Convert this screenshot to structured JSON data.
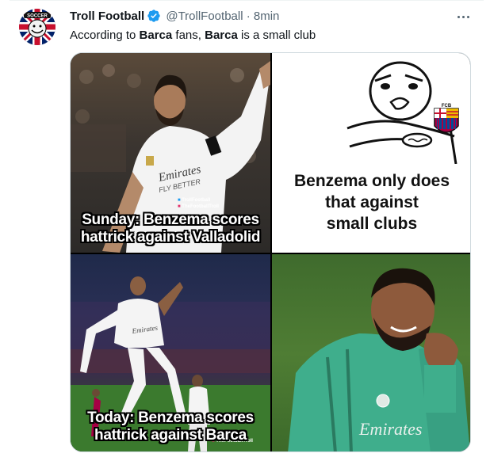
{
  "tweet": {
    "author_name": "Troll Football",
    "handle": "@TrollFootball",
    "separator": "·",
    "time": "8min",
    "text_parts": [
      "According to ",
      "Barca",
      " fans, ",
      "Barca",
      " is a small club"
    ]
  },
  "avatar": {
    "text": "SOCCER"
  },
  "meme": {
    "top_left_caption": [
      "Sunday: Benzema scores",
      "hattrick against Valladolid"
    ],
    "top_right_text": [
      "Benzema only does",
      "that against",
      "small clubs"
    ],
    "bottom_left_caption": [
      "Today: Benzema scores",
      "hattrick against Barca"
    ],
    "shirt_sponsor": "Emirates",
    "shirt_slogan": "FLY BETTER",
    "club_crest_text": "FCB",
    "watermarks": [
      "TrollFootball",
      "TheFootballTroll"
    ]
  },
  "colors": {
    "verified": "#1d9bf0",
    "secondary_text": "#536471",
    "border": "#cfd9de"
  },
  "icons": [
    "verified-icon",
    "more-options-icon",
    "twitter-icon",
    "instagram-icon"
  ]
}
